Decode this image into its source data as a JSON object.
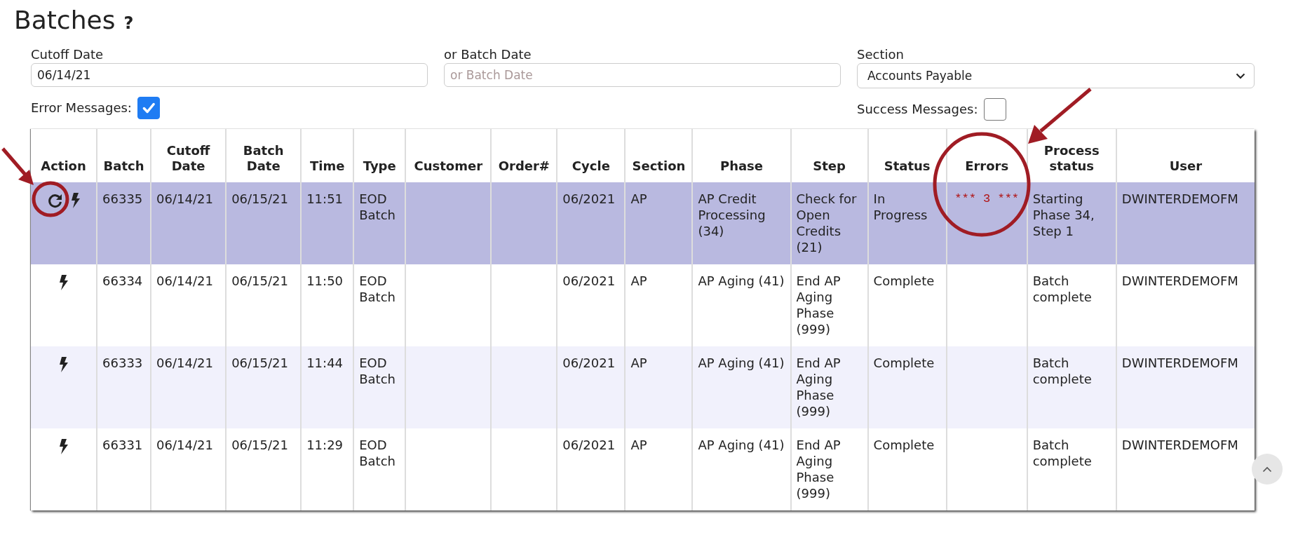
{
  "page": {
    "title": "Batches",
    "help": "?"
  },
  "filters": {
    "cutoff_date": {
      "label": "Cutoff Date",
      "value": "06/14/21"
    },
    "batch_date": {
      "label": "or Batch Date",
      "placeholder": "or Batch Date"
    },
    "section": {
      "label": "Section",
      "value": "Accounts Payable"
    },
    "error_messages": {
      "label": "Error Messages:",
      "checked": true
    },
    "success_messages": {
      "label": "Success Messages:",
      "checked": false
    }
  },
  "table": {
    "columns": [
      "Action",
      "Batch",
      "Cutoff Date",
      "Batch Date",
      "Time",
      "Type",
      "Customer",
      "Order#",
      "Cycle",
      "Section",
      "Phase",
      "Step",
      "Status",
      "Errors",
      "Process status",
      "User"
    ],
    "rows": [
      {
        "selected": true,
        "restartable": true,
        "cells": [
          "",
          "66335",
          "06/14/21",
          "06/15/21",
          "11:51",
          "EOD Batch",
          "",
          "",
          "06/2021",
          "AP",
          "AP Credit Processing (34)",
          "Check for Open Credits (21)",
          "In Progress",
          "*** 3 ***",
          "Starting Phase 34, Step 1",
          "DWINTERDEMOFM"
        ]
      },
      {
        "selected": false,
        "restartable": false,
        "cells": [
          "",
          "66334",
          "06/14/21",
          "06/15/21",
          "11:50",
          "EOD Batch",
          "",
          "",
          "06/2021",
          "AP",
          "AP Aging (41)",
          "End AP Aging Phase (999)",
          "Complete",
          "",
          "Batch complete",
          "DWINTERDEMOFM"
        ]
      },
      {
        "selected": false,
        "restartable": false,
        "cells": [
          "",
          "66333",
          "06/14/21",
          "06/15/21",
          "11:44",
          "EOD Batch",
          "",
          "",
          "06/2021",
          "AP",
          "AP Aging (41)",
          "End AP Aging Phase (999)",
          "Complete",
          "",
          "Batch complete",
          "DWINTERDEMOFM"
        ]
      },
      {
        "selected": false,
        "restartable": false,
        "cells": [
          "",
          "66331",
          "06/14/21",
          "06/15/21",
          "11:29",
          "EOD Batch",
          "",
          "",
          "06/2021",
          "AP",
          "AP Aging (41)",
          "End AP Aging Phase (999)",
          "Complete",
          "",
          "Batch complete",
          "DWINTERDEMOFM"
        ]
      }
    ]
  }
}
